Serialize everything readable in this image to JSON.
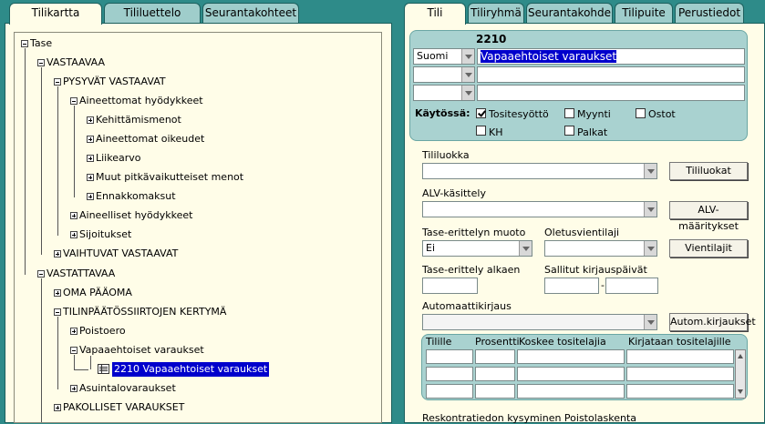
{
  "left_tabs": [
    "Tilikartta",
    "Tililuettelo",
    "Seurantakohteet"
  ],
  "right_tabs": [
    "Tili",
    "Tiliryhmä",
    "Seurantakohde",
    "Tilipuite",
    "Perustiedot"
  ],
  "tree": {
    "nodes": [
      "Tase",
      "VASTAAVAA",
      "PYSYVÄT VASTAAVAT",
      "Aineettomat hyödykkeet",
      "Kehittämismenot",
      "Aineettomat oikeudet",
      "Liikearvo",
      "Muut pitkävaikutteiset menot",
      "Ennakkomaksut",
      "Aineelliset hyödykkeet",
      "Sijoitukset",
      "VAIHTUVAT VASTAAVAT",
      "VASTATTAVAA",
      "OMA PÄÄOMA",
      "TILINPÄÄTÖSSIIRTOJEN KERTYMÄ",
      "Poistoero",
      "Vapaaehtoiset varaukset",
      "2210 Vapaaehtoiset varaukset",
      "Asuintalovaraukset",
      "PAKOLLISET VARAUKSET"
    ]
  },
  "account": {
    "number": "2210",
    "language": "Suomi",
    "name": "Vapaaehtoiset varaukset",
    "kaytossa_label": "Käytössä:",
    "checks": [
      {
        "label": "Tositesyöttö",
        "checked": true
      },
      {
        "label": "Myynti",
        "checked": false
      },
      {
        "label": "Ostot",
        "checked": false
      },
      {
        "label": "KH",
        "checked": false
      },
      {
        "label": "Palkat",
        "checked": false
      }
    ]
  },
  "form": {
    "tililuokka_label": "Tililuokka",
    "tililuokat_button": "Tililuokat",
    "alv_label": "ALV-käsittely",
    "alv_button": "ALV-määritykset",
    "tase_erittely_label": "Tase-erittelyn muoto",
    "tase_erittely_value": "Ei",
    "oletusvientilaji_label": "Oletusvientilaji",
    "vientilajit_button": "Vientilajit",
    "tase_alkaen_label": "Tase-erittely alkaen",
    "sallitut_label": "Sallitut kirjauspäivät",
    "date_separator": "-",
    "autom_label": "Automaattikirjaus",
    "autom_button": "Autom.kirjaukset",
    "grid_headers": [
      "Tilille",
      "Prosentti",
      "Koskee tositelajia",
      "Kirjataan tositelajille"
    ],
    "bottom_label": "Reskontratiedon kysyminen  Poistolaskenta"
  }
}
